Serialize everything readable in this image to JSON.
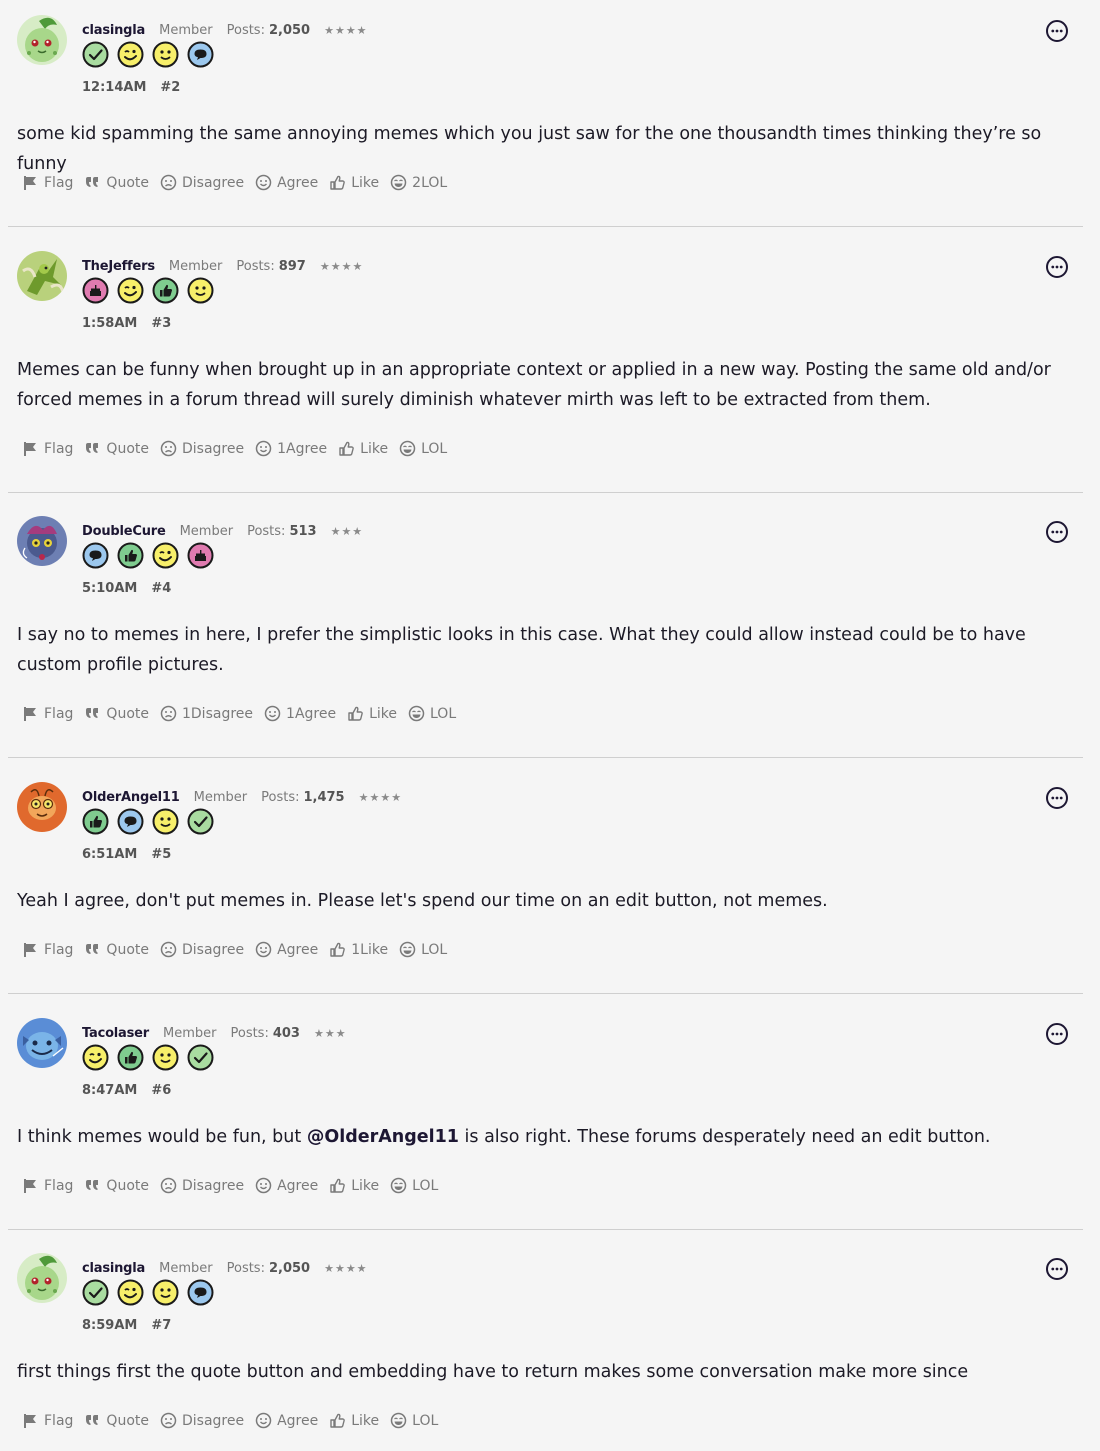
{
  "colors": {
    "background": "#f5f5f5",
    "username": "#1d1733",
    "muted": "#7a7a7a",
    "divider": "#cfcfcf"
  },
  "actions_labels": {
    "flag": "Flag",
    "quote": "Quote",
    "disagree": "Disagree",
    "agree": "Agree",
    "like": "Like",
    "lol": "LOL"
  },
  "posts": [
    {
      "username": "clasingla",
      "role": "Member",
      "posts_label": "Posts:",
      "posts_count": "2,050",
      "stars": "★★★★",
      "avatar": "chikorita",
      "badges": [
        "check-badge",
        "wink-badge",
        "smile-badge",
        "speech-badge"
      ],
      "time": "12:14AM",
      "number": "#2",
      "body": "some kid spamming the same annoying memes which you just saw for the one thousandth times thinking they’re so funny",
      "counts": {
        "disagree": "",
        "agree": "",
        "like": "",
        "lol": "2"
      }
    },
    {
      "username": "TheJeffers",
      "role": "Member",
      "posts_label": "Posts:",
      "posts_count": "897",
      "stars": "★★★★",
      "avatar": "scyther",
      "badges": [
        "cake-badge",
        "wink-badge",
        "thumbs-up-badge",
        "smile-badge"
      ],
      "time": "1:58AM",
      "number": "#3",
      "body": "Memes can be funny when brought up in an appropriate context or applied in a new way. Posting the same old and/or forced memes in a forum thread will surely diminish whatever mirth was left to be extracted from them.",
      "counts": {
        "disagree": "",
        "agree": "1",
        "like": "",
        "lol": ""
      }
    },
    {
      "username": "DoubleCure",
      "role": "Member",
      "posts_label": "Posts:",
      "posts_count": "513",
      "stars": "★★★",
      "avatar": "misdreavus",
      "badges": [
        "speech-badge",
        "thumbs-up-badge",
        "wink-badge",
        "cake-badge"
      ],
      "time": "5:10AM",
      "number": "#4",
      "body": "I say no to memes in here, I prefer the simplistic looks in this case. What they could allow instead could be to have custom profile pictures.",
      "counts": {
        "disagree": "1",
        "agree": "1",
        "like": "",
        "lol": ""
      }
    },
    {
      "username": "OlderAngel11",
      "role": "Member",
      "posts_label": "Posts:",
      "posts_count": "1,475",
      "stars": "★★★★",
      "avatar": "orange-creature",
      "badges": [
        "thumbs-up-badge",
        "speech-badge",
        "smile-badge",
        "check-badge"
      ],
      "time": "6:51AM",
      "number": "#5",
      "body": "Yeah I agree, don't put memes in. Please let's spend our time on an edit button, not memes.",
      "counts": {
        "disagree": "",
        "agree": "",
        "like": "1",
        "lol": ""
      }
    },
    {
      "username": "Tacolaser",
      "role": "Member",
      "posts_label": "Posts:",
      "posts_count": "403",
      "stars": "★★★",
      "avatar": "wooper",
      "badges": [
        "wink-badge",
        "thumbs-up-badge",
        "smile-badge",
        "check-badge"
      ],
      "time": "8:47AM",
      "number": "#6",
      "body_before": "I think memes would be fun, but ",
      "mention": "@OlderAngel11",
      "body_after": " is also right. These forums desperately need an edit button.",
      "counts": {
        "disagree": "",
        "agree": "",
        "like": "",
        "lol": ""
      }
    },
    {
      "username": "clasingla",
      "role": "Member",
      "posts_label": "Posts:",
      "posts_count": "2,050",
      "stars": "★★★★",
      "avatar": "chikorita",
      "badges": [
        "check-badge",
        "wink-badge",
        "smile-badge",
        "speech-badge"
      ],
      "time": "8:59AM",
      "number": "#7",
      "body": "first things first the quote button and embedding have to return makes some conversation make more since",
      "counts": {
        "disagree": "",
        "agree": "",
        "like": "",
        "lol": ""
      }
    }
  ]
}
